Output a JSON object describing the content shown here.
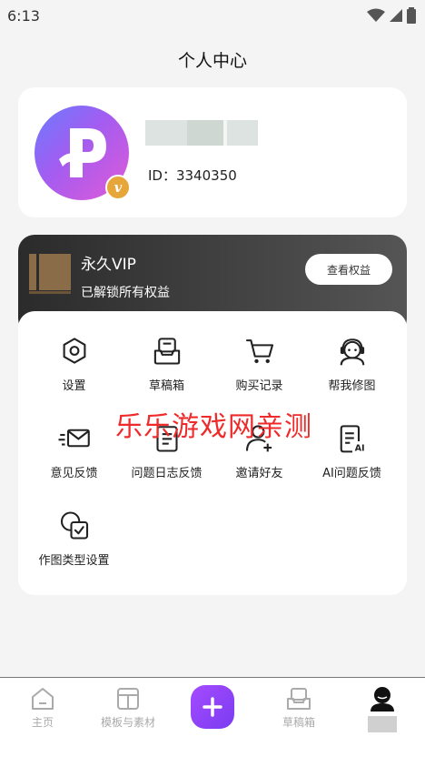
{
  "status_bar": {
    "time": "6:13"
  },
  "header": {
    "title": "个人中心"
  },
  "profile": {
    "id_text": "ID：3340350",
    "badge_letter": "v",
    "avatar_letter": "P"
  },
  "vip": {
    "title": "永久VIP",
    "subtitle": "已解锁所有权益",
    "button_label": "查看权益"
  },
  "menu": {
    "items": [
      {
        "label": "设置",
        "icon": "settings-icon"
      },
      {
        "label": "草稿箱",
        "icon": "draft-box-icon"
      },
      {
        "label": "购买记录",
        "icon": "cart-icon"
      },
      {
        "label": "帮我修图",
        "icon": "support-agent-icon"
      },
      {
        "label": "意见反馈",
        "icon": "mail-icon"
      },
      {
        "label": "问题日志反馈",
        "icon": "log-document-icon"
      },
      {
        "label": "邀请好友",
        "icon": "add-user-icon"
      },
      {
        "label": "AI问题反馈",
        "icon": "ai-document-icon"
      },
      {
        "label": "作图类型设置",
        "icon": "type-settings-icon"
      }
    ]
  },
  "watermark": "乐乐游戏网亲测",
  "bottom_nav": {
    "items": [
      {
        "label": "主页",
        "icon": "home-icon"
      },
      {
        "label": "模板与素材",
        "icon": "template-icon"
      },
      {
        "label": "",
        "icon": "plus-icon"
      },
      {
        "label": "草稿箱",
        "icon": "draft-box-icon"
      },
      {
        "label": "",
        "icon": "profile-icon"
      }
    ]
  },
  "colors": {
    "accent": "#8e44f5",
    "watermark": "#ee2b2b",
    "vip_badge": "#e6a63a"
  }
}
